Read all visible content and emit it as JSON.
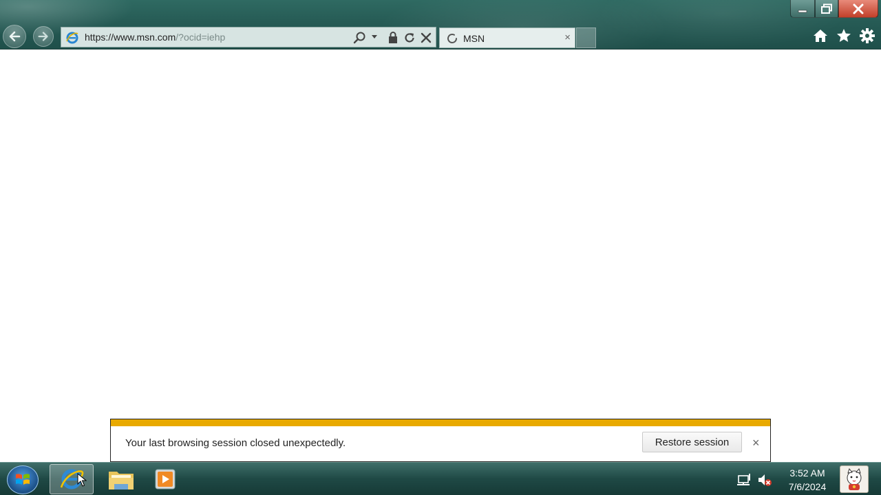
{
  "window": {
    "minimize_icon": "minimize-icon",
    "maximize_icon": "restore-icon",
    "close_icon": "close-icon"
  },
  "navigation": {
    "back_icon": "back-arrow-icon",
    "forward_icon": "forward-arrow-icon"
  },
  "address_bar": {
    "url_main": "https://www.msn.com",
    "url_rest": "/?ocid=iehp",
    "icons": [
      "ie-page-icon",
      "search-icon",
      "dropdown-icon",
      "lock-icon",
      "refresh-icon",
      "stop-icon"
    ]
  },
  "tab": {
    "title": "MSN",
    "close": "×",
    "loading_icon": "loading-spinner-icon"
  },
  "command_icons": [
    "home-icon",
    "favorites-star-icon",
    "settings-gear-icon"
  ],
  "notification": {
    "message": "Your last browsing session closed unexpectedly.",
    "button_label": "Restore session",
    "close": "×",
    "accent_color": "#e8a900"
  },
  "taskbar": {
    "start_icon": "windows-start-orb-icon",
    "pinned": [
      "internet-explorer-icon",
      "file-explorer-icon",
      "media-player-icon"
    ],
    "tray_icons": [
      "network-icon",
      "volume-muted-icon"
    ],
    "time": "3:52 AM",
    "date": "7/6/2024",
    "user_icon": "lucky-cat-avatar-icon"
  }
}
